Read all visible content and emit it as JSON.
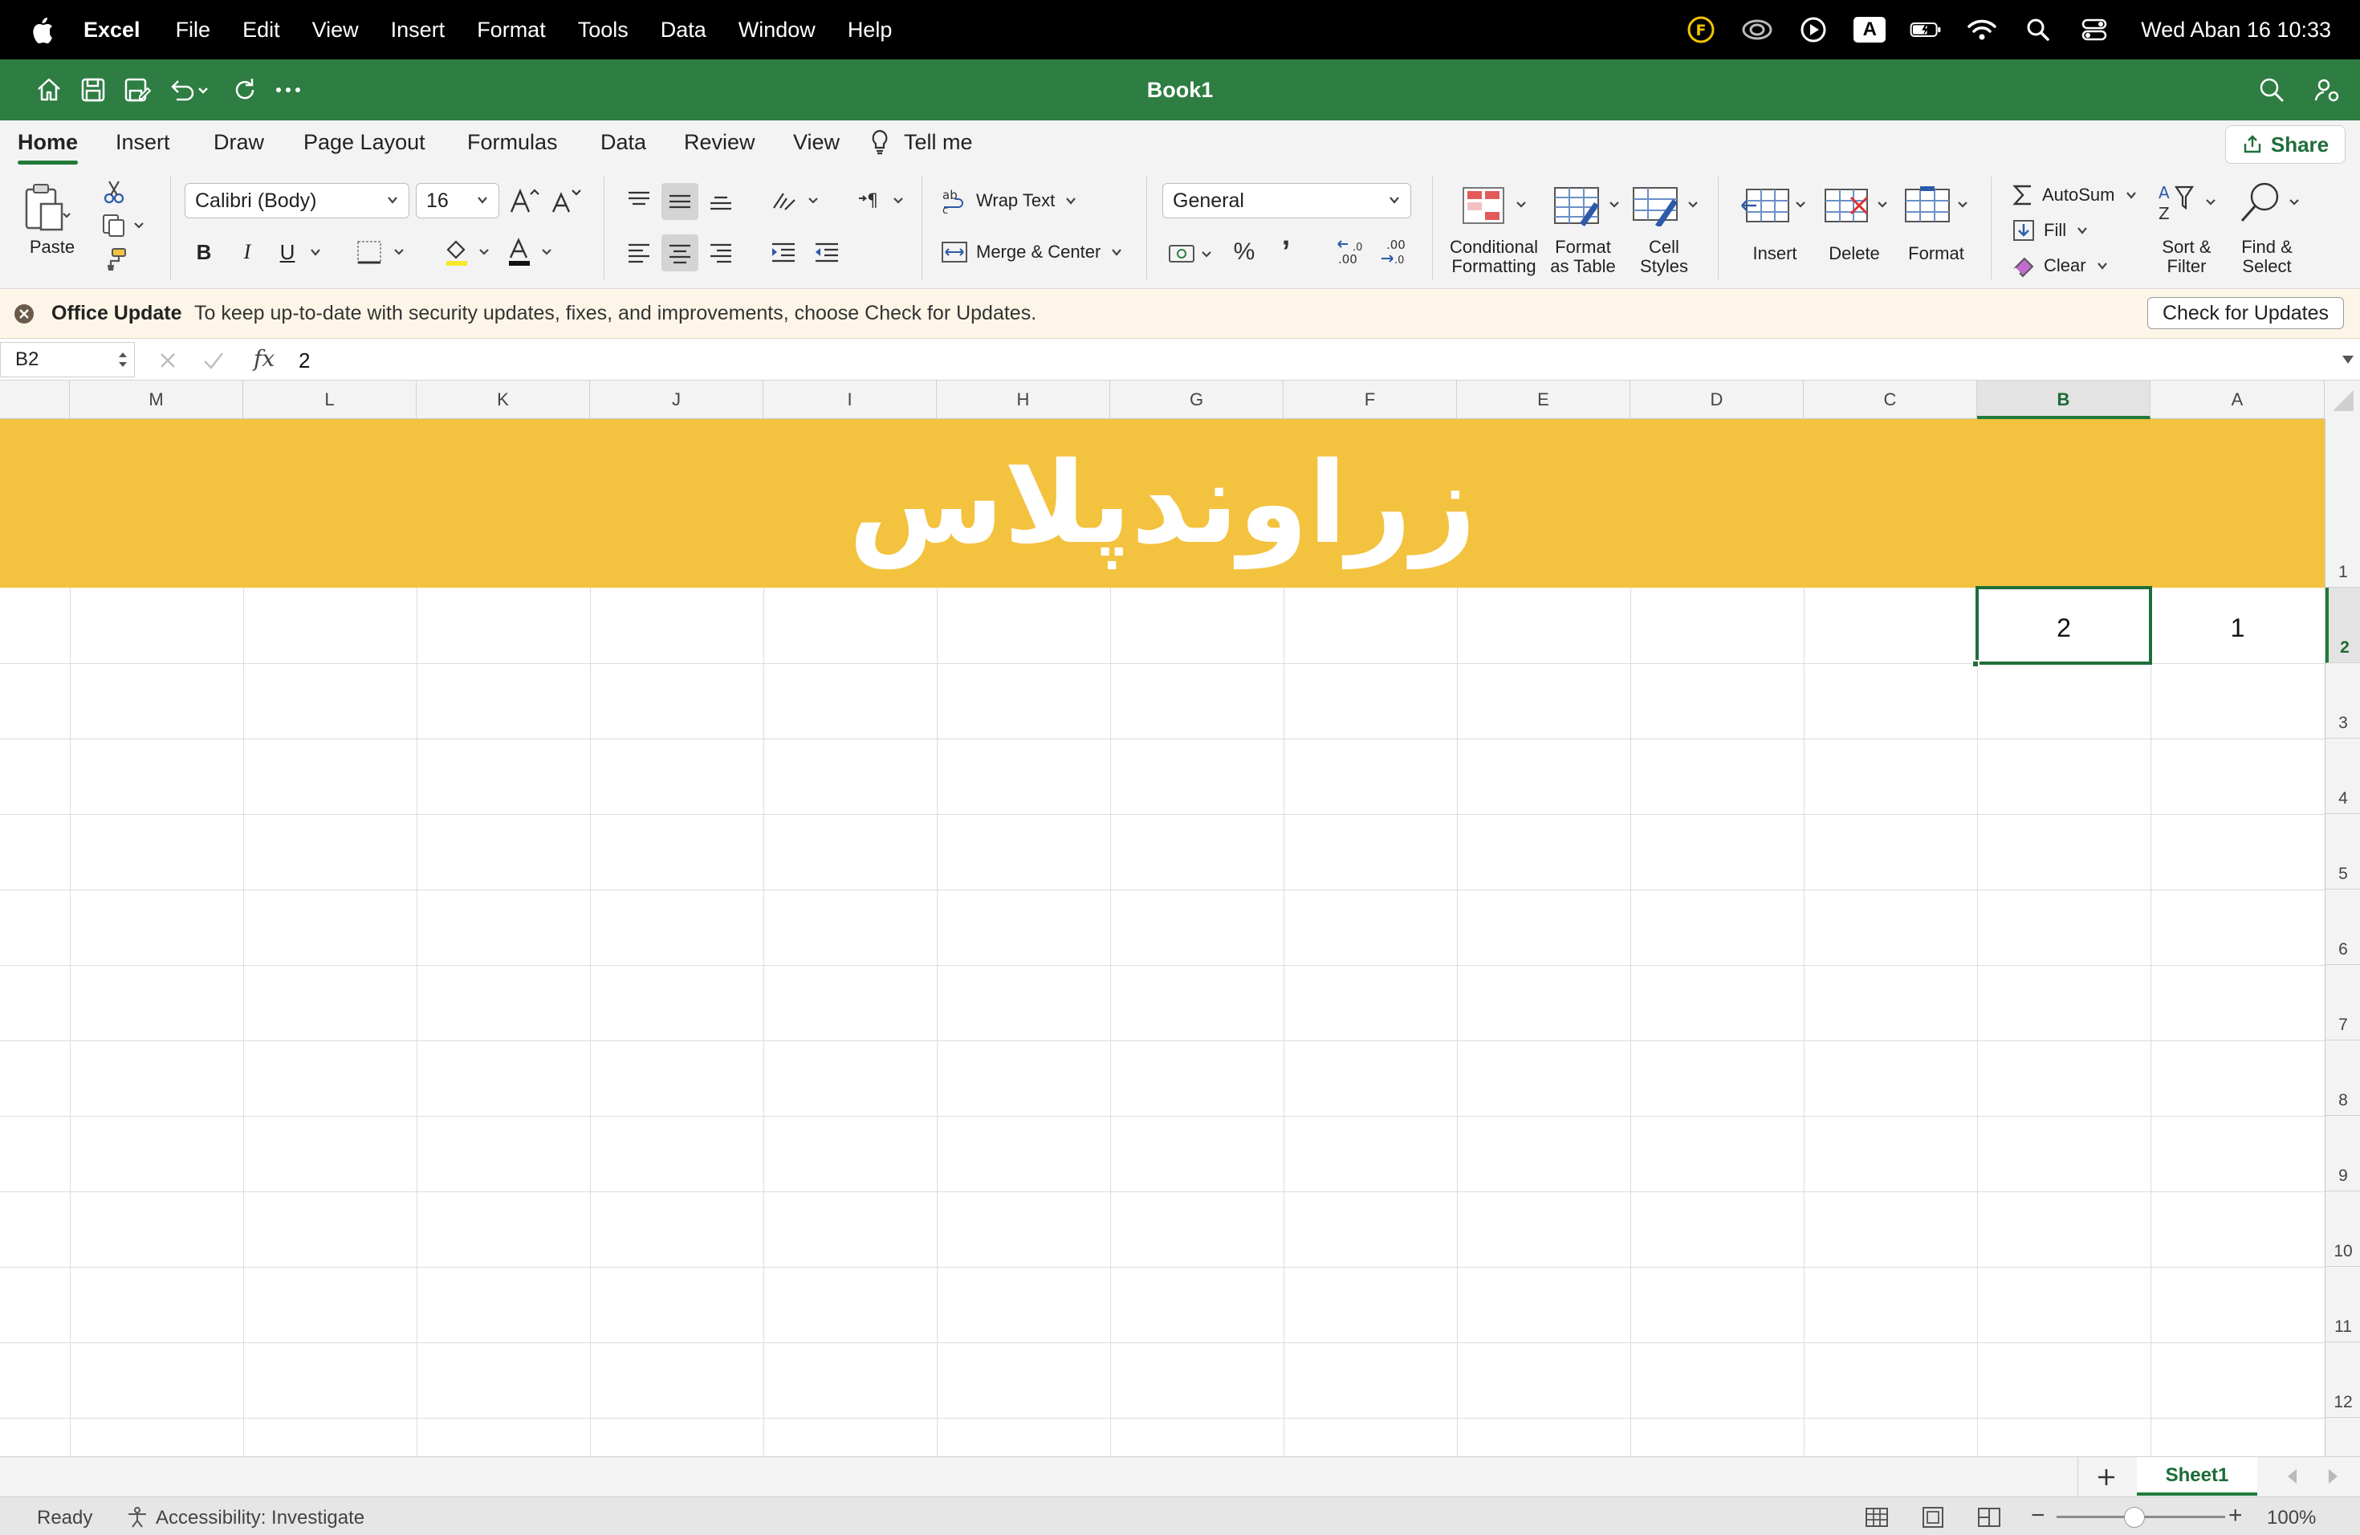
{
  "menubar": {
    "app_name": "Excel",
    "items": [
      "File",
      "Edit",
      "View",
      "Insert",
      "Format",
      "Tools",
      "Data",
      "Window",
      "Help"
    ],
    "status_icons": [
      "font-f-icon",
      "creative-cloud-icon",
      "play-circle-icon",
      "input-a-icon",
      "battery-icon",
      "wifi-icon",
      "spotlight-search-icon",
      "control-center-icon"
    ],
    "input_source_letter": "A",
    "clock": "Wed Aban 16  10:33"
  },
  "titlebar": {
    "title": "Book1",
    "quick_access": [
      "home-icon",
      "save-icon",
      "save-as-icon",
      "undo-icon",
      "redo-icon",
      "more-icon"
    ],
    "color": "#2e7d42"
  },
  "ribbon_tabs": {
    "tabs": [
      "Home",
      "Insert",
      "Draw",
      "Page Layout",
      "Formulas",
      "Data",
      "Review",
      "View"
    ],
    "active": "Home",
    "tell_me": "Tell me",
    "share": "Share"
  },
  "ribbon": {
    "paste": "Paste",
    "font_name": "Calibri (Body)",
    "font_size": "16",
    "bold": "B",
    "italic": "I",
    "underline": "U",
    "wrap_text": "Wrap Text",
    "merge_center": "Merge & Center",
    "number_format": "General",
    "percent": "%",
    "comma": "’",
    "conditional_formatting": [
      "Conditional",
      "Formatting"
    ],
    "format_as_table": [
      "Format",
      "as Table"
    ],
    "cell_styles": [
      "Cell",
      "Styles"
    ],
    "insert": "Insert",
    "delete": "Delete",
    "format": "Format",
    "autosum": "AutoSum",
    "fill": "Fill",
    "clear": "Clear",
    "sort_filter": [
      "Sort &",
      "Filter"
    ],
    "find_select": [
      "Find &",
      "Select"
    ]
  },
  "notification": {
    "title": "Office Update",
    "message": "To keep up-to-date with security updates, fixes, and improvements, choose Check for Updates.",
    "button": "Check for Updates"
  },
  "formula_bar": {
    "name_box": "B2",
    "fx": "fx",
    "value": "2"
  },
  "sheet": {
    "columns": [
      "M",
      "L",
      "K",
      "J",
      "I",
      "H",
      "G",
      "F",
      "E",
      "D",
      "C",
      "B",
      "A"
    ],
    "selected_column": "B",
    "rows": [
      "1",
      "2",
      "3",
      "4",
      "5",
      "6",
      "7",
      "8",
      "9",
      "10",
      "11",
      "12"
    ],
    "selected_row": "2",
    "banner_text": "زراوندپلاس",
    "banner_color": "#f3c23f",
    "cells": {
      "A2": "1",
      "B2": "2"
    }
  },
  "sheet_tabs": {
    "add": "+",
    "active": "Sheet1"
  },
  "status": {
    "ready": "Ready",
    "accessibility": "Accessibility: Investigate",
    "zoom": "100%",
    "zoom_out": "−",
    "zoom_in": "+"
  },
  "accent_color": "#1f7a3a"
}
